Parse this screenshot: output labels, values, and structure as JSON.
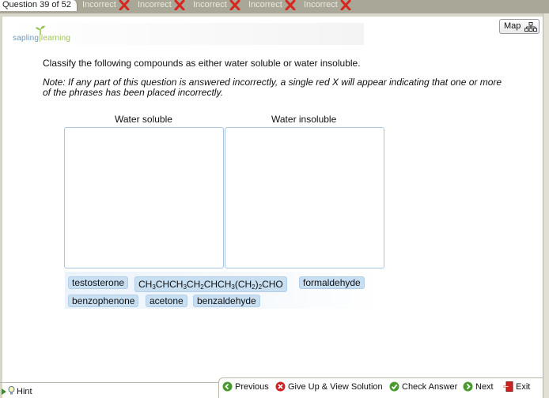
{
  "tabs": {
    "question_label": "Question 39 of 52",
    "attempts": [
      "Incorrect",
      "Incorrect",
      "Incorrect",
      "Incorrect",
      "Incorrect"
    ]
  },
  "header": {
    "map_label": "Map",
    "logo_left": "sapling",
    "logo_right": "learning"
  },
  "question": {
    "instruction": "Classify the following compounds as either water soluble or water insoluble.",
    "note": "Note: If any part of this question is answered incorrectly, a single red X will appear indicating that one or more of the phrases has been placed incorrectly."
  },
  "bins": [
    {
      "title": "Water soluble",
      "items": []
    },
    {
      "title": "Water insoluble",
      "items": []
    }
  ],
  "chips": {
    "testosterone": "testosterone",
    "formula": {
      "parts": [
        "CH",
        "3",
        "CHCH",
        "3",
        "CH",
        "2",
        "CHCH",
        "3",
        "(CH",
        "2",
        ")",
        "2",
        "CHO"
      ]
    },
    "formaldehyde": "formaldehyde",
    "benzophenone": "benzophenone",
    "acetone": "acetone",
    "benzaldehyde": "benzaldehyde"
  },
  "footer": {
    "hint": "Hint",
    "previous": "Previous",
    "give_up": "Give Up & View Solution",
    "check": "Check Answer",
    "next": "Next",
    "exit": "Exit"
  },
  "colors": {
    "tab_strip": "#a9a797",
    "chip_bg": "#c8def1",
    "bin_border": "#a9c6e0",
    "incorrect_x": "#d7261e",
    "nav_green": "#4a9b2e"
  }
}
